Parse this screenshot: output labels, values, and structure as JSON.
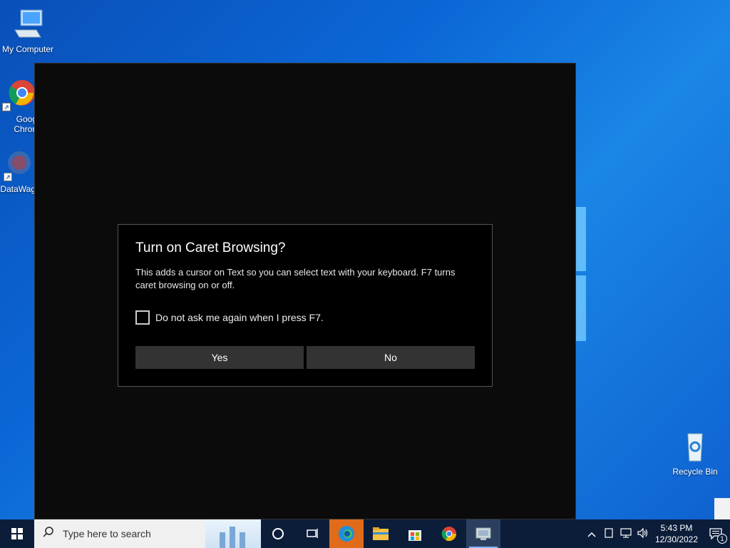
{
  "desktop": {
    "icons": [
      {
        "label": "My Computer",
        "icon": "computer-icon"
      },
      {
        "label": "Goog\nChron",
        "icon": "chrome-icon"
      },
      {
        "label": "DataWag",
        "icon": "datawag-icon"
      },
      {
        "label": "Recycle Bin",
        "icon": "recycle-bin-icon"
      }
    ]
  },
  "dialog": {
    "title": "Turn on Caret Browsing?",
    "body": "This adds a cursor on Text so you can select text with your keyboard. F7 turns caret browsing on or off.",
    "checkbox_label": "Do not ask me again when I press F7.",
    "checkbox_checked": false,
    "yes_label": "Yes",
    "no_label": "No"
  },
  "taskbar": {
    "search_placeholder": "Type here to search",
    "pinned": [
      "cortana-icon",
      "task-view-icon",
      "edge-icon",
      "file-explorer-icon",
      "store-icon",
      "chrome-icon",
      "app-icon"
    ],
    "time": "5:43 PM",
    "date": "12/30/2022",
    "notification_count": "1",
    "colors": {
      "taskbar": "#0c1d3a",
      "edge_highlight": "#e06b1a"
    }
  }
}
